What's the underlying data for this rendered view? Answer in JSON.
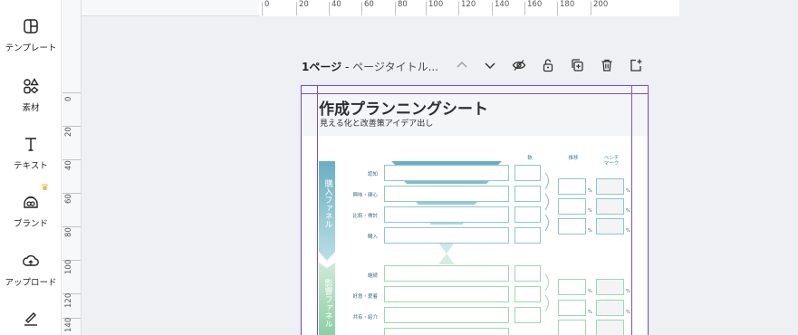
{
  "sidebar": {
    "items": [
      {
        "label": "テンプレート",
        "icon": "template-icon"
      },
      {
        "label": "素材",
        "icon": "elements-icon"
      },
      {
        "label": "テキスト",
        "icon": "text-icon"
      },
      {
        "label": "ブランド",
        "icon": "brand-icon"
      },
      {
        "label": "アップロード",
        "icon": "upload-icon"
      },
      {
        "label": "",
        "icon": "draw-icon"
      }
    ]
  },
  "ruler": {
    "horizontal": [
      "0",
      "20",
      "40",
      "60",
      "80",
      "100",
      "120",
      "140",
      "160",
      "180",
      "200"
    ],
    "vertical": [
      "0",
      "20",
      "40",
      "60",
      "80",
      "100",
      "120",
      "140"
    ]
  },
  "page_header": {
    "page_number": "1ページ",
    "separator": " - ",
    "page_title_placeholder": "ページタイトル...",
    "tools": [
      "chevron-up-icon",
      "chevron-down-icon",
      "hide-icon",
      "lock-icon",
      "duplicate-icon",
      "delete-icon",
      "add-page-icon"
    ]
  },
  "document": {
    "title": "作成プランニングシート",
    "subtitle": "見える化と改善策アイデア出し",
    "column_headers": {
      "count": "数",
      "rate": "推移",
      "bench": "ベンチ\nマーク"
    },
    "purchase_funnel": {
      "label": "購入ファネル",
      "rows": [
        "認知",
        "興味・関心",
        "比較・検討",
        "購入"
      ]
    },
    "influence_funnel": {
      "label": "影響ファネル",
      "rows": [
        "継続",
        "好意・愛着",
        "共有・紹介",
        ""
      ]
    },
    "percent_sign": "%"
  },
  "colors": {
    "accent": "#7b4fd6",
    "funnel_blue": "#7fbfcf",
    "funnel_green": "#9fd6b4",
    "crown": "#f5a623"
  }
}
